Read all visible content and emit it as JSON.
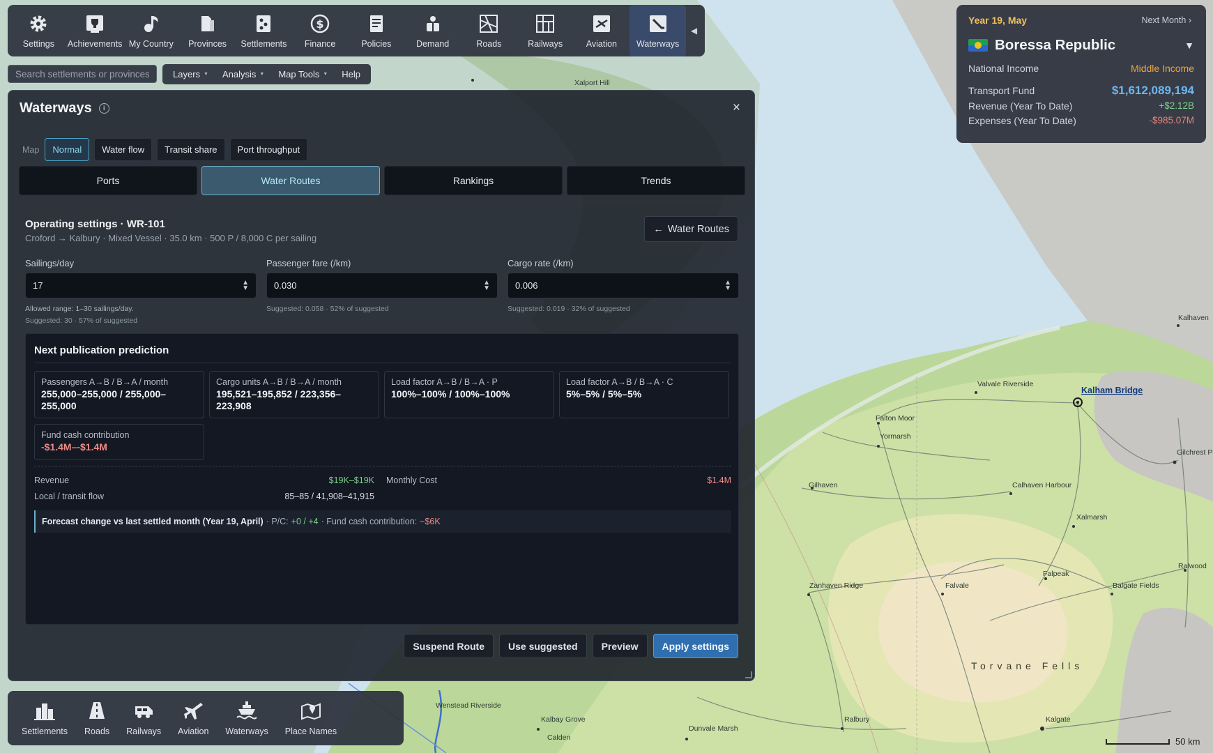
{
  "toolbar": {
    "items": [
      {
        "label": "Settings",
        "icon": "gear-icon"
      },
      {
        "label": "Achievements",
        "icon": "trophy-icon"
      },
      {
        "label": "My Country",
        "icon": "anthem-icon"
      },
      {
        "label": "Provinces",
        "icon": "province-icon"
      },
      {
        "label": "Settlements",
        "icon": "settlement-icon"
      },
      {
        "label": "Finance",
        "icon": "dollar-icon"
      },
      {
        "label": "Policies",
        "icon": "policy-icon"
      },
      {
        "label": "Demand",
        "icon": "demand-icon"
      },
      {
        "label": "Roads",
        "icon": "roads-icon"
      },
      {
        "label": "Railways",
        "icon": "railways-icon"
      },
      {
        "label": "Aviation",
        "icon": "aviation-icon"
      },
      {
        "label": "Waterways",
        "icon": "waterways-icon"
      }
    ],
    "active": "Waterways"
  },
  "search": {
    "placeholder": "Search settlements or provinces"
  },
  "menus": [
    {
      "label": "Layers",
      "has_caret": true
    },
    {
      "label": "Analysis",
      "has_caret": true
    },
    {
      "label": "Map Tools",
      "has_caret": true
    },
    {
      "label": "Help",
      "has_caret": false
    }
  ],
  "info": {
    "date": "Year 19, May",
    "next_month": "Next Month ›",
    "country": "Boressa Republic",
    "national_income_label": "National Income",
    "national_income_value": "Middle Income",
    "transport_fund_label": "Transport Fund",
    "transport_fund_value": "$1,612,089,194",
    "revenue_label": "Revenue (Year To Date)",
    "revenue_value": "+$2.12B",
    "expenses_label": "Expenses (Year To Date)",
    "expenses_value": "-$985.07M"
  },
  "panel": {
    "title": "Waterways",
    "close": "×",
    "map_label": "Map",
    "map_modes": [
      "Normal",
      "Water flow",
      "Transit share",
      "Port throughput"
    ],
    "map_mode_active": "Normal",
    "tabs": [
      "Ports",
      "Water Routes",
      "Rankings",
      "Trends"
    ],
    "tab_active": "Water Routes",
    "op_title": "Operating settings · WR-101",
    "op_sub": "Croford → Kalbury · Mixed Vessel · 35.0 km · 500 P / 8,000 C per sailing",
    "back_label": "Water Routes",
    "fields": {
      "sailings": {
        "label": "Sailings/day",
        "value": "17",
        "hint1": "Allowed range: 1–30 sailings/day.",
        "hint2": "Suggested: 30 · 57% of suggested"
      },
      "fare": {
        "label": "Passenger fare (/km)",
        "value": "0.030",
        "hint1": "Suggested: 0.058 · 52% of suggested"
      },
      "cargo": {
        "label": "Cargo rate (/km)",
        "value": "0.006",
        "hint1": "Suggested: 0.019 · 32% of suggested"
      }
    },
    "prediction": {
      "title": "Next publication prediction",
      "cards": [
        {
          "label": "Passengers A→B / B→A / month",
          "value": "255,000–255,000 / 255,000–255,000"
        },
        {
          "label": "Cargo units A→B / B→A / month",
          "value": "195,521–195,852 / 223,356–223,908"
        },
        {
          "label": "Load factor A→B / B→A · P",
          "value": "100%–100% / 100%–100%"
        },
        {
          "label": "Load factor A→B / B→A · C",
          "value": "5%–5% / 5%–5%"
        },
        {
          "label": "Fund cash contribution",
          "value": "-$1.4M–-$1.4M"
        }
      ],
      "revenue_label": "Revenue",
      "revenue_value": "$19K–$19K",
      "monthly_cost_label": "Monthly Cost",
      "monthly_cost_value": "$1.4M",
      "flow_label": "Local / transit flow",
      "flow_value": "85–85 / 41,908–41,915",
      "forecast_title": "Forecast change vs last settled month (Year 19, April)",
      "forecast_pc_label": "· P/C:",
      "forecast_pc_value": "+0 / +4",
      "forecast_fund_label": "· Fund cash contribution:",
      "forecast_fund_value": "−$6K"
    },
    "actions": [
      "Suspend Route",
      "Use suggested",
      "Preview",
      "Apply settings"
    ]
  },
  "bottom_toolbar": [
    {
      "label": "Settlements",
      "icon": "settlements-layer-icon"
    },
    {
      "label": "Roads",
      "icon": "roads-layer-icon"
    },
    {
      "label": "Railways",
      "icon": "railways-layer-icon"
    },
    {
      "label": "Aviation",
      "icon": "aviation-layer-icon"
    },
    {
      "label": "Waterways",
      "icon": "waterways-layer-icon"
    },
    {
      "label": "Place Names",
      "icon": "place-names-icon"
    }
  ],
  "map": {
    "labels": [
      "Xalport Hill",
      "Kalhaven",
      "Valvale Riverside",
      "Kalham Bridge",
      "Falton Moor",
      "Yormarsh",
      "Gilchrest Por",
      "Gilhaven",
      "Calhaven Harbour",
      "Xalmarsh",
      "Ralwood",
      "Falpeak",
      "Zanhaven Ridge",
      "Falvale",
      "Balgate Fields",
      "Torvane Fells",
      "Wenstead Riverside",
      "Kalbay Grove",
      "Calden",
      "Dunvale Marsh",
      "Ralbury",
      "Kalgate"
    ],
    "scale_label": "50 km"
  }
}
